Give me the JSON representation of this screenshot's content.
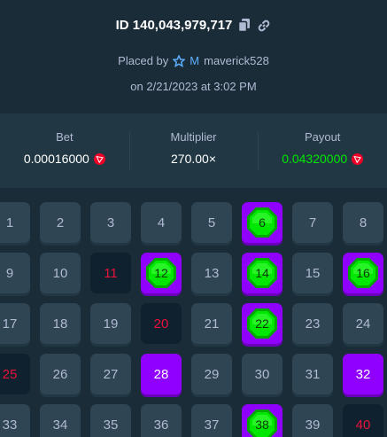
{
  "header": {
    "id_label": "ID 140,043,979,717",
    "placed_by_label": "Placed by",
    "vip_rank": "M",
    "username": "maverick528",
    "date_text": "on 2/21/2023 at 3:02 PM"
  },
  "stats": {
    "bet_label": "Bet",
    "bet_value": "0.00016000",
    "multiplier_label": "Multiplier",
    "multiplier_value": "270.00×",
    "payout_label": "Payout",
    "payout_value": "0.04320000"
  },
  "colors": {
    "background": "#1a2c38",
    "tile": "#2f4553",
    "picked": "#9000ff",
    "gem": "#00e701",
    "miss": "#e9113c",
    "payout": "#00e701"
  },
  "board": {
    "tiles": [
      {
        "number": "1",
        "state": "normal"
      },
      {
        "number": "2",
        "state": "normal"
      },
      {
        "number": "3",
        "state": "normal"
      },
      {
        "number": "4",
        "state": "normal"
      },
      {
        "number": "5",
        "state": "normal"
      },
      {
        "number": "6",
        "state": "hit"
      },
      {
        "number": "7",
        "state": "normal"
      },
      {
        "number": "8",
        "state": "normal"
      },
      {
        "number": "9",
        "state": "normal"
      },
      {
        "number": "10",
        "state": "normal"
      },
      {
        "number": "11",
        "state": "miss"
      },
      {
        "number": "12",
        "state": "hit"
      },
      {
        "number": "13",
        "state": "normal"
      },
      {
        "number": "14",
        "state": "hit"
      },
      {
        "number": "15",
        "state": "normal"
      },
      {
        "number": "16",
        "state": "hit"
      },
      {
        "number": "17",
        "state": "normal"
      },
      {
        "number": "18",
        "state": "normal"
      },
      {
        "number": "19",
        "state": "normal"
      },
      {
        "number": "20",
        "state": "miss"
      },
      {
        "number": "21",
        "state": "normal"
      },
      {
        "number": "22",
        "state": "hit"
      },
      {
        "number": "23",
        "state": "normal"
      },
      {
        "number": "24",
        "state": "normal"
      },
      {
        "number": "25",
        "state": "miss"
      },
      {
        "number": "26",
        "state": "normal"
      },
      {
        "number": "27",
        "state": "normal"
      },
      {
        "number": "28",
        "state": "picked"
      },
      {
        "number": "29",
        "state": "normal"
      },
      {
        "number": "30",
        "state": "normal"
      },
      {
        "number": "31",
        "state": "normal"
      },
      {
        "number": "32",
        "state": "picked"
      },
      {
        "number": "33",
        "state": "normal"
      },
      {
        "number": "34",
        "state": "normal"
      },
      {
        "number": "35",
        "state": "normal"
      },
      {
        "number": "36",
        "state": "normal"
      },
      {
        "number": "37",
        "state": "normal"
      },
      {
        "number": "38",
        "state": "hit"
      },
      {
        "number": "39",
        "state": "normal"
      },
      {
        "number": "40",
        "state": "miss"
      }
    ]
  }
}
